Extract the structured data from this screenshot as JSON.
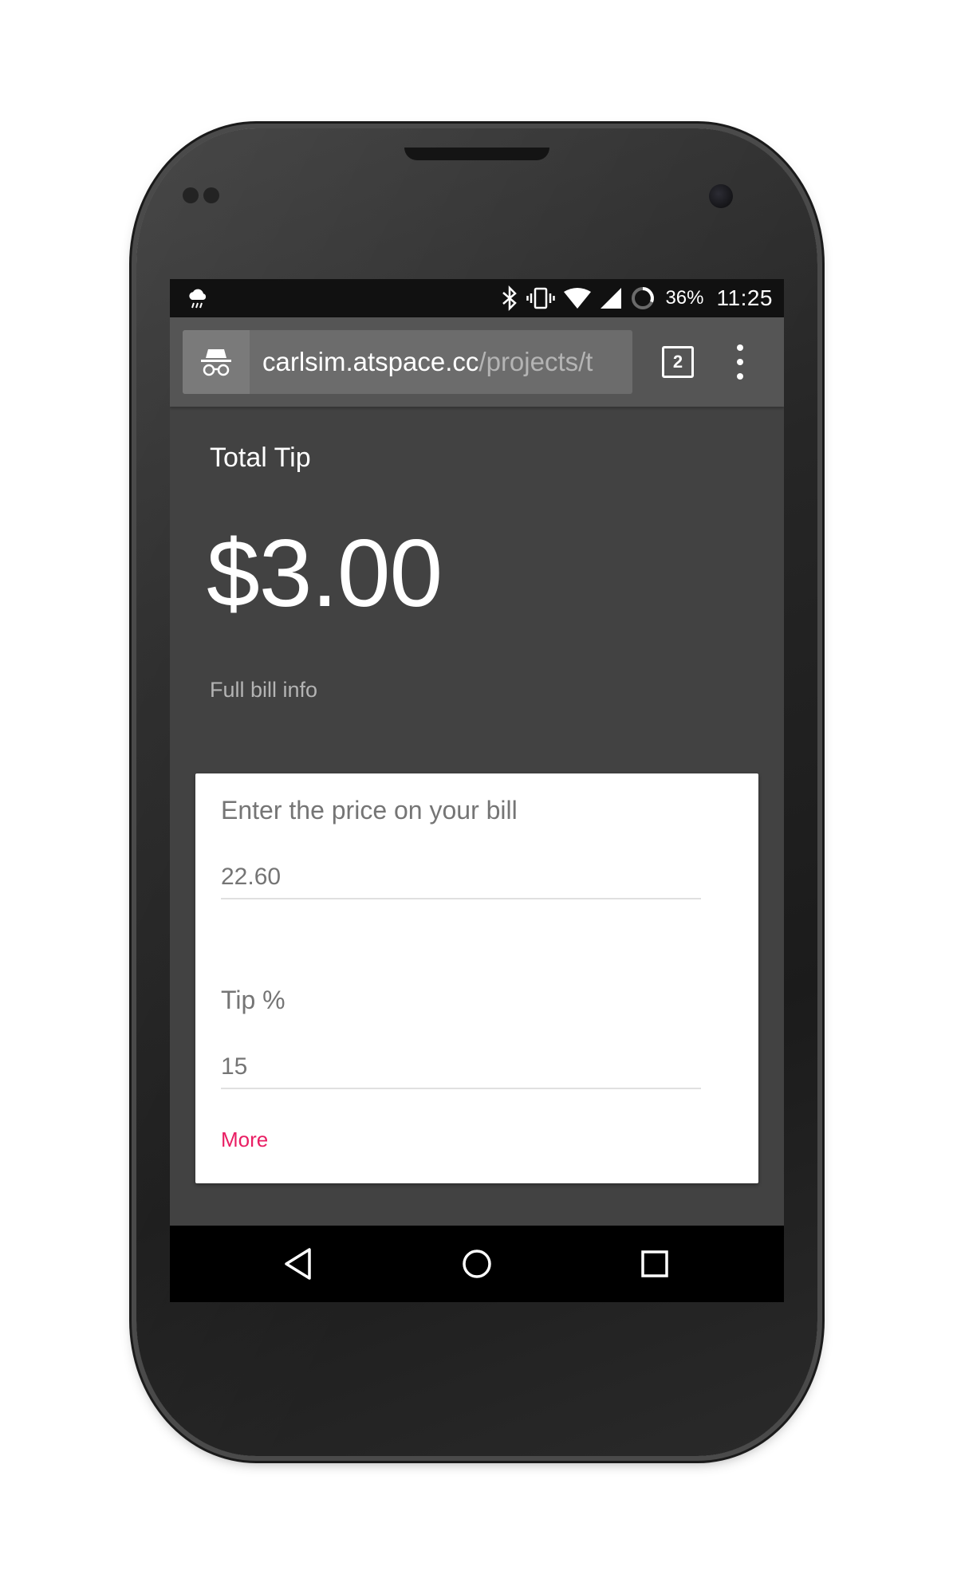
{
  "status_bar": {
    "battery_percent": "36%",
    "time": "11:25",
    "icons": [
      "weather-rain-icon",
      "bluetooth-icon",
      "vibrate-icon",
      "wifi-icon",
      "cell-signal-icon",
      "battery-icon"
    ]
  },
  "browser": {
    "url_host": "carlsim.atspace.cc",
    "url_path": "/projects/t",
    "tab_count": "2",
    "icons": [
      "incognito-icon",
      "tab-switcher-icon",
      "overflow-menu-icon"
    ]
  },
  "main": {
    "total_tip_label": "Total Tip",
    "total_tip_amount": "$3.00",
    "full_bill_link": "Full bill info"
  },
  "form": {
    "bill_label": "Enter the price on your bill",
    "bill_value": "22.60",
    "tip_label": "Tip %",
    "tip_value": "15",
    "more_link": "More"
  },
  "nav_bar": {
    "icons": [
      "back-icon",
      "home-icon",
      "recents-icon"
    ]
  },
  "colors": {
    "page_background": "#424242",
    "toolbar": "#555555",
    "accent_link": "#e91e63",
    "card": "#ffffff"
  }
}
